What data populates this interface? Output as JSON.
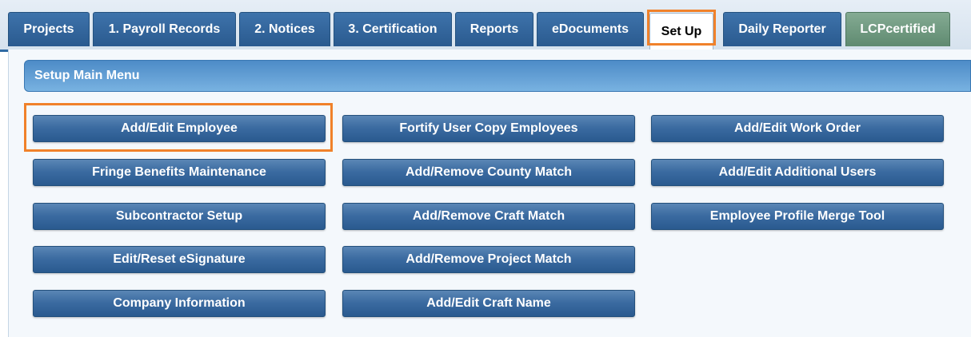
{
  "tabs": [
    {
      "label": "Projects"
    },
    {
      "label": "1. Payroll Records"
    },
    {
      "label": "2. Notices"
    },
    {
      "label": "3. Certification"
    },
    {
      "label": "Reports"
    },
    {
      "label": "eDocuments"
    },
    {
      "label": "Set Up",
      "active": true
    },
    {
      "label": "Daily Reporter"
    },
    {
      "label": "LCPcertified"
    }
  ],
  "menu": {
    "title": "Setup Main Menu",
    "column1": [
      "Add/Edit Employee",
      "Fringe Benefits Maintenance",
      "Subcontractor Setup",
      "Edit/Reset eSignature",
      "Company Information"
    ],
    "column2": [
      "Fortify User Copy Employees",
      "Add/Remove County Match",
      "Add/Remove Craft Match",
      "Add/Remove Project Match",
      "Add/Edit Craft Name"
    ],
    "column3": [
      "Add/Edit Work Order",
      "Add/Edit Additional Users",
      "Employee Profile Merge Tool"
    ]
  },
  "colors": {
    "tab_blue": "#2f6aa3",
    "tab_green": "#6f9a80",
    "highlight": "#f0812a",
    "button_blue": "#3a6aa0"
  }
}
